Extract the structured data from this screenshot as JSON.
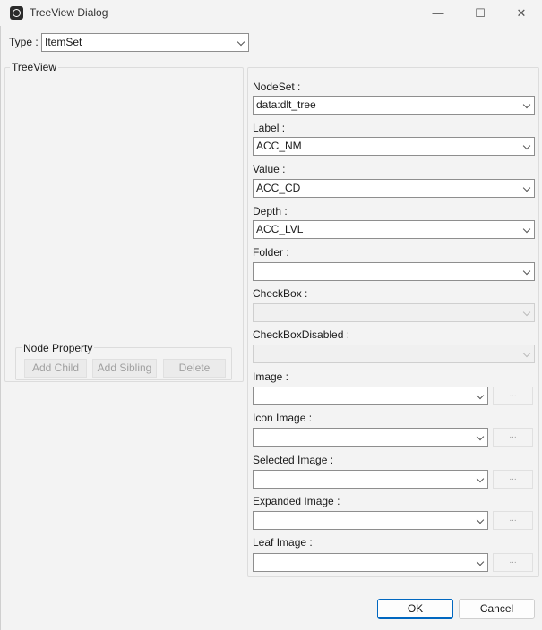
{
  "window": {
    "title": "TreeView Dialog",
    "minimize": "—",
    "maximize": "☐",
    "close": "✕"
  },
  "type": {
    "label": "Type :",
    "value": "ItemSet"
  },
  "treeview": {
    "legend": "TreeView"
  },
  "node_property": {
    "legend": "Node Property",
    "add_child": "Add Child",
    "add_sibling": "Add Sibling",
    "delete": "Delete"
  },
  "fields": {
    "nodeset": {
      "label": "NodeSet :",
      "value": "data:dlt_tree"
    },
    "label": {
      "label": "Label :",
      "value": "ACC_NM"
    },
    "value": {
      "label": "Value :",
      "value": "ACC_CD"
    },
    "depth": {
      "label": "Depth :",
      "value": "ACC_LVL"
    },
    "folder": {
      "label": "Folder :",
      "value": ""
    },
    "checkbox": {
      "label": "CheckBox :",
      "value": ""
    },
    "checkbox_disabled": {
      "label": "CheckBoxDisabled :",
      "value": ""
    },
    "image": {
      "label": "Image :",
      "value": ""
    },
    "icon_image": {
      "label": "Icon Image :",
      "value": ""
    },
    "selected_image": {
      "label": "Selected Image :",
      "value": ""
    },
    "expanded_image": {
      "label": "Expanded Image :",
      "value": ""
    },
    "leaf_image": {
      "label": "Leaf Image :",
      "value": ""
    }
  },
  "browse_label": "...",
  "footer": {
    "ok": "OK",
    "cancel": "Cancel"
  }
}
